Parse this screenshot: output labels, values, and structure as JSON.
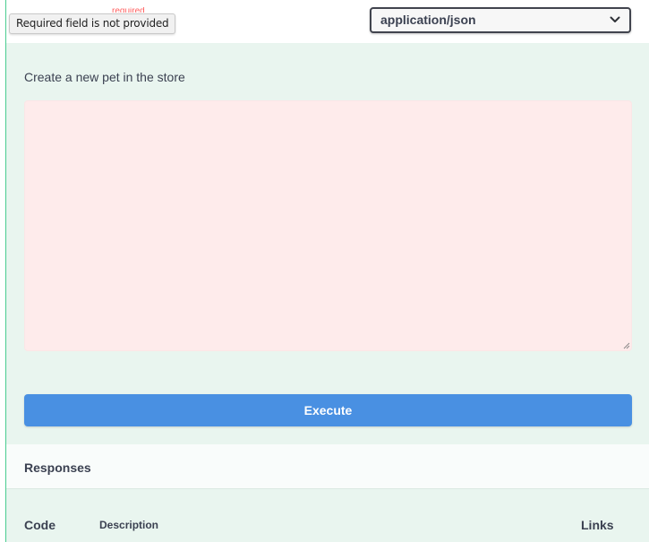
{
  "parameter": {
    "required_label": "required",
    "tooltip": "Required field is not provided",
    "content_type": {
      "selected": "application/json",
      "icon": "chevron-down-icon"
    }
  },
  "request_body": {
    "description": "Create a new pet in the store",
    "value": "",
    "error_background": "#feebeb"
  },
  "execute": {
    "label": "Execute",
    "color": "#4990e2"
  },
  "responses": {
    "title": "Responses",
    "columns": {
      "code": "Code",
      "description": "Description",
      "links": "Links"
    }
  },
  "colors": {
    "accent": "#49cc90",
    "panel_bg": "#e9f5ef"
  }
}
